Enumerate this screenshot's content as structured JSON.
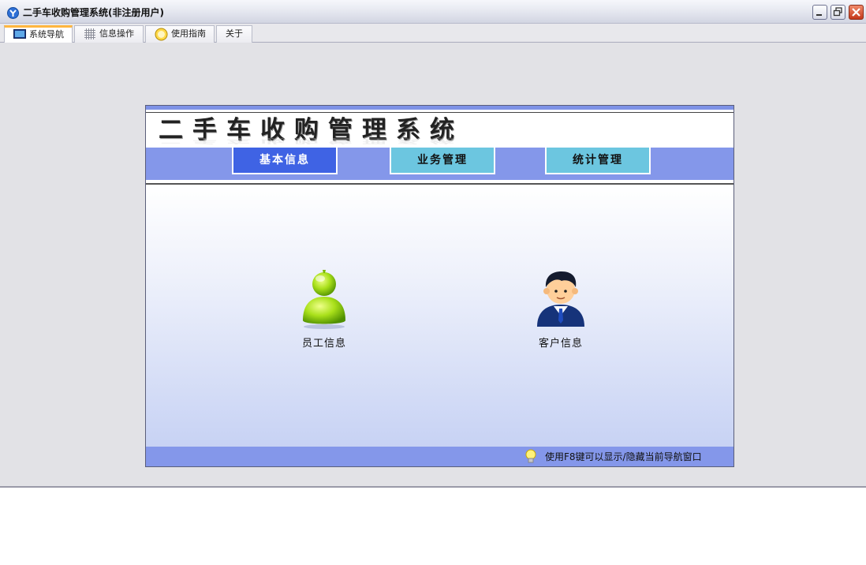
{
  "window": {
    "title": "二手车收购管理系统(非注册用户)"
  },
  "tabs": [
    {
      "label": "系统导航",
      "icon": "monitor-icon",
      "active": true
    },
    {
      "label": "信息操作",
      "icon": "grid-icon",
      "active": false
    },
    {
      "label": "使用指南",
      "icon": "guide-icon",
      "active": false
    },
    {
      "label": "关于",
      "icon": "",
      "active": false
    }
  ],
  "nav": {
    "title": "二手车收购管理系统",
    "buttons": [
      {
        "label": "基本信息",
        "active": true
      },
      {
        "label": "业务管理",
        "active": false
      },
      {
        "label": "统计管理",
        "active": false
      }
    ],
    "entries": [
      {
        "label": "员工信息",
        "icon": "employee-user-icon"
      },
      {
        "label": "客户信息",
        "icon": "customer-businessman-icon"
      }
    ],
    "footer_hint": "使用F8键可以显示/隐藏当前导航窗口"
  },
  "colors": {
    "accent_bar": "#8497ea",
    "active_button": "#3f63e4",
    "inactive_button": "#6cc6e0",
    "active_tab_top": "#ffb640"
  }
}
